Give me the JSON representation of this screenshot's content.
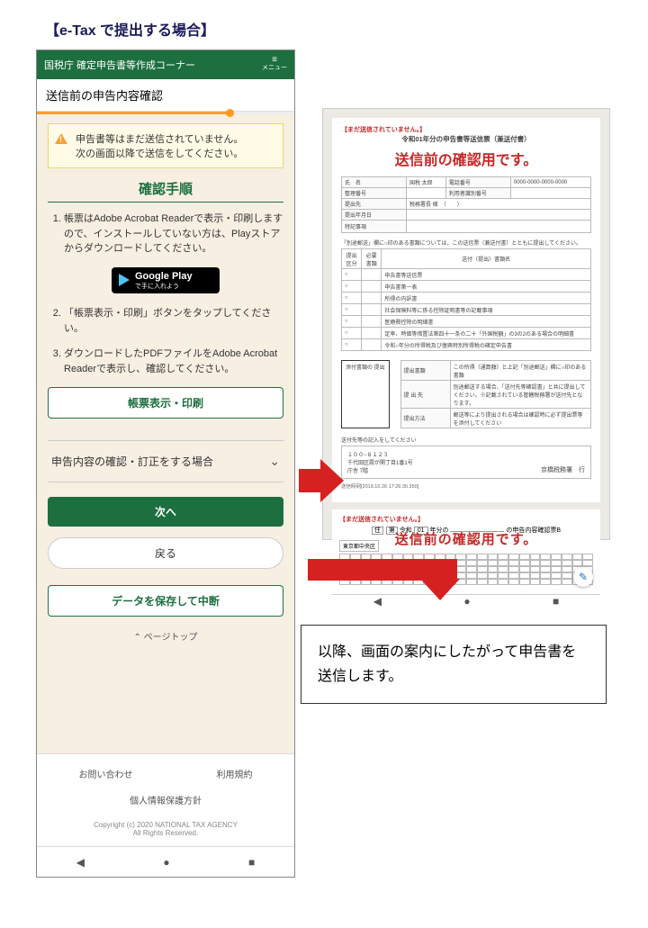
{
  "title": "【e-Tax で提出する場合】",
  "phone": {
    "appbar_title": "国税庁 確定申告書等作成コーナー",
    "menu_label": "メニュー",
    "subheader": "送信前の申告内容確認",
    "alert_line1": "申告書等はまだ送信されていません。",
    "alert_line2": "次の画面以降で送信をしてください。",
    "section_title": "確認手順",
    "steps": {
      "s1": "帳票はAdobe Acrobat Readerで表示・印刷しますので、インストールしていない方は、Playストアからダウンロードしてください。",
      "s2": "「帳票表示・印刷」ボタンをタップしてください。",
      "s3": "ダウンロードしたPDFファイルをAdobe Acrobat Readerで表示し、確認してください。"
    },
    "gplay_big": "Google Play",
    "gplay_small": "で手に入れよう",
    "btn_print": "帳票表示・印刷",
    "collapse": "申告内容の確認・訂正をする場合",
    "btn_next": "次へ",
    "btn_back": "戻る",
    "btn_save": "データを保存して中断",
    "pagetop": "ページトップ",
    "footer_contact": "お問い合わせ",
    "footer_terms": "利用規約",
    "footer_privacy": "個人情報保護方針",
    "copyright": "Copyright (c) 2020 NATIONAL TAX AGENCY",
    "rights": "All Rights Reserved."
  },
  "preview": {
    "nosend": "【まだ送信されていません。】",
    "doc1_title": "令和01年分の申告書等送信票（兼送付書）",
    "stamp": "送信前の確認用です。",
    "fields": {
      "name_lbl": "氏　名",
      "name_val": "国税 太郎",
      "seiri_lbl": "整理番号",
      "seiri_val": "",
      "tel_lbl": "電話番号",
      "tel_val": "0000-0000-0000-0000",
      "riyou_lbl": "利用者識別番号",
      "riyou_val": "",
      "teisei_lbl": "提出先",
      "teisei_val": "税務署長 様　（　　）",
      "nenbun_lbl": "提出年月日",
      "nenbun_val": "",
      "tokki_lbl": "特記事項",
      "tokki_val": ""
    },
    "note": "「別途郵送」欄に○印のある書類については、この送信票（兼送付書）とともに提出してください。",
    "tbl_headers": {
      "h1": "提出\n区分",
      "h2": "必要書類",
      "h3": "送付（提出）書類名"
    },
    "tbl_rows": [
      "申告書等送信票",
      "申告書第一表",
      "所得の内訳書",
      "社会保険料等に係る控除証明書等の記載事項",
      "医療費控除の明細書",
      "定率、時価等措置法第四十一条の二十「外国税額」の3の2のある場合の明細書",
      "令和○年分の所得税及び復興特別所得税の確定申告書"
    ],
    "addr_box_lbl": "添付書類の\n提出",
    "addr_right_lbl1": "提出書類",
    "addr_right_val1": "この所得（通算額）と上記「別途郵送」欄に○印のある書類",
    "addr_right_lbl2": "提 出 先",
    "addr_right_val2": "別途郵送する場合、「送付先等確認書」と共に提出してください。※記載されている管轄税務署が送付先となります。",
    "addr_right_lbl3": "提出方法",
    "addr_right_val3": "郵送等により提出される場合は確認時に必ず提出票等を添付してください",
    "sendto_lbl": "送付先等の記入をしてください",
    "zip": "１００−８１２３",
    "addr": "千代田区霞が関丁目1番1号\n庁舎 7階",
    "office": "京橋税務署　行",
    "timestamp": "送信時刻[2019.10.26 17:26:30.350]",
    "doc2_form_title_prefix": "令和",
    "doc2_year": "01",
    "doc2_form_title_suffix": "年分の",
    "doc2_form_title_suffix2": "の申告内容確認票B",
    "doc2_locale": "東京都中央区",
    "stamp2": "送信前の確認用です。",
    "fab_icon": "✎"
  },
  "callout": "以降、画面の案内にしたがって申告書を送信します。"
}
